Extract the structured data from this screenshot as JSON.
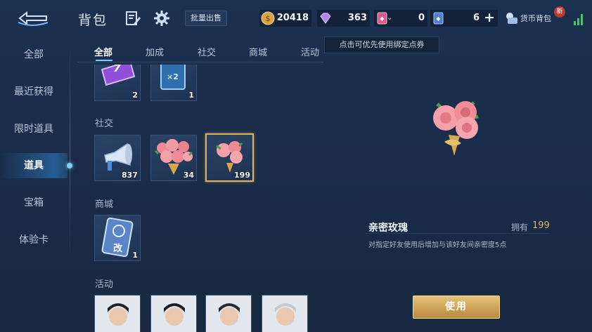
{
  "header": {
    "title": "背包",
    "batch_sell": "批量出售",
    "gold": "20418",
    "diamond": "363",
    "ticket_a": "0",
    "ticket_b": "6",
    "wallet_label": "货币背包",
    "new_badge": "新"
  },
  "tooltip": "点击可优先使用绑定点券",
  "sidebar": {
    "items": [
      {
        "label": "全部"
      },
      {
        "label": "最近获得"
      },
      {
        "label": "限时道具"
      },
      {
        "label": "道具"
      },
      {
        "label": "宝箱"
      },
      {
        "label": "体验卡"
      }
    ],
    "active_index": 3
  },
  "tabs": [
    {
      "label": "全部"
    },
    {
      "label": "加成"
    },
    {
      "label": "社交"
    },
    {
      "label": "商城"
    },
    {
      "label": "活动"
    }
  ],
  "sections": {
    "top_items": [
      {
        "name": "purple-ticket",
        "count": "2",
        "icon_text": "7"
      },
      {
        "name": "exp-card",
        "count": "1",
        "icon_text": "×2"
      }
    ],
    "social": {
      "title": "社交",
      "items": [
        {
          "name": "megaphone",
          "count": "837"
        },
        {
          "name": "rose-bouquet",
          "count": "34"
        },
        {
          "name": "intimate-rose",
          "count": "199"
        }
      ]
    },
    "mall": {
      "title": "商城",
      "items": [
        {
          "name": "rename-card",
          "count": "1",
          "icon_text": "改"
        }
      ]
    },
    "activity": {
      "title": "活动"
    }
  },
  "detail": {
    "name": "亲密玫瑰",
    "own_label": "拥有",
    "own_count": "199",
    "description": "对指定好友使用后增加与该好友间亲密度5点",
    "use_button": "使用"
  },
  "colors": {
    "accent": "#7fd0ff",
    "gold": "#e0b25a",
    "background": "#1a2d4a"
  }
}
